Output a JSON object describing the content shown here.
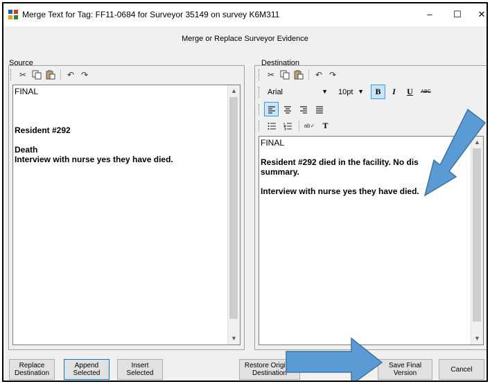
{
  "window": {
    "title": "Merge Text for Tag: FF11-0684 for Surveyor 35149 on survey K6M311",
    "minimize": "–",
    "maximize": "☐",
    "close": "✕"
  },
  "header": {
    "label": "Merge or Replace Surveyor Evidence"
  },
  "source": {
    "label": "Source",
    "lines": {
      "l1": "FINAL",
      "l2": "Resident #292",
      "l3": "Death",
      "l4": "Interview with nurse yes they have died."
    }
  },
  "destination": {
    "label": "Destination",
    "font_name": "Arial",
    "font_size": "10pt",
    "lines": {
      "l1": "FINAL",
      "l2": "Resident #292 died in the facility. No dis",
      "l3": "summary.",
      "l4": "Interview with nurse yes they have died."
    }
  },
  "buttons": {
    "replace": [
      "Replace",
      "Destination"
    ],
    "append": [
      "Append",
      "Selected"
    ],
    "insert": [
      "Insert",
      "Selected"
    ],
    "restore": [
      "Restore Original",
      "Destination"
    ],
    "save": [
      "Save Final",
      "Version"
    ],
    "cancel": "Cancel"
  },
  "icons": {
    "cut": "scissors-icon",
    "copy": "copy-icon",
    "paste": "paste-icon",
    "undo": "undo-icon",
    "redo": "redo-icon",
    "bold": "bold-icon",
    "italic": "italic-icon",
    "underline": "underline-icon",
    "strike": "strikethrough-icon",
    "align_left": "align-left-icon",
    "align_center": "align-center-icon",
    "align_right": "align-right-icon",
    "justify": "justify-icon",
    "bullets": "bullet-list-icon",
    "numbering": "numbered-list-icon",
    "spell": "spellcheck-icon",
    "font": "font-icon"
  },
  "colors": {
    "arrow": "#5b9bd5",
    "arrow_border": "#41719c",
    "focus": "#0078d7"
  }
}
